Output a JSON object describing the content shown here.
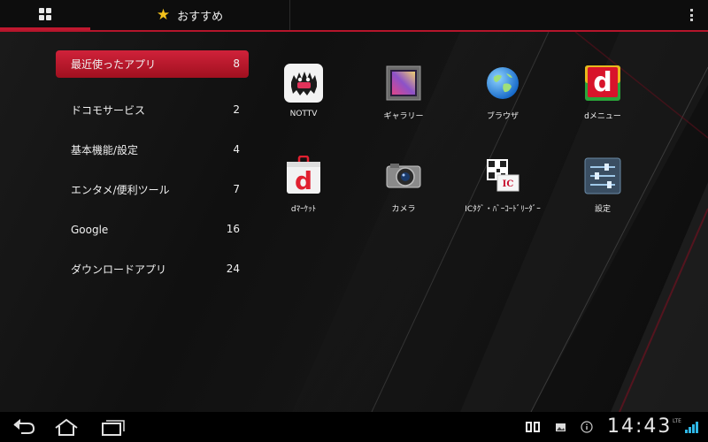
{
  "tabs": {
    "grid_icon": "grid-icon",
    "favorites_label": "おすすめ",
    "favorites_icon": "star-icon"
  },
  "colors": {
    "accent": "#c0182f",
    "star": "#f5c21b"
  },
  "categories": [
    {
      "label": "最近使ったアプリ",
      "count": "8",
      "selected": true
    },
    {
      "label": "ドコモサービス",
      "count": "2"
    },
    {
      "label": "基本機能/設定",
      "count": "4"
    },
    {
      "label": "エンタメ/便利ツール",
      "count": "7"
    },
    {
      "label": "Google",
      "count": "16"
    },
    {
      "label": "ダウンロードアプリ",
      "count": "24"
    }
  ],
  "apps": [
    {
      "name": "NOTTV",
      "icon": "nottv-icon"
    },
    {
      "name": "ギャラリー",
      "icon": "gallery-icon"
    },
    {
      "name": "ブラウザ",
      "icon": "browser-globe-icon"
    },
    {
      "name": "dメニュー",
      "icon": "dmenu-icon"
    },
    {
      "name": "dﾏｰｹｯﾄ",
      "icon": "dmarket-bag-icon"
    },
    {
      "name": "カメラ",
      "icon": "camera-icon"
    },
    {
      "name": "ICﾀｸﾞ・ﾊﾞｰｺｰﾄﾞﾘｰﾀﾞｰ",
      "icon": "qr-reader-icon"
    },
    {
      "name": "設定",
      "icon": "settings-sliders-icon"
    }
  ],
  "system_bar": {
    "clock": "14:43",
    "network": "LTE",
    "nav_icons": [
      "back-icon",
      "home-icon",
      "recent-apps-icon"
    ],
    "status_icons": [
      "book-icon",
      "image-notification-icon",
      "info-icon",
      "signal-icon"
    ]
  }
}
